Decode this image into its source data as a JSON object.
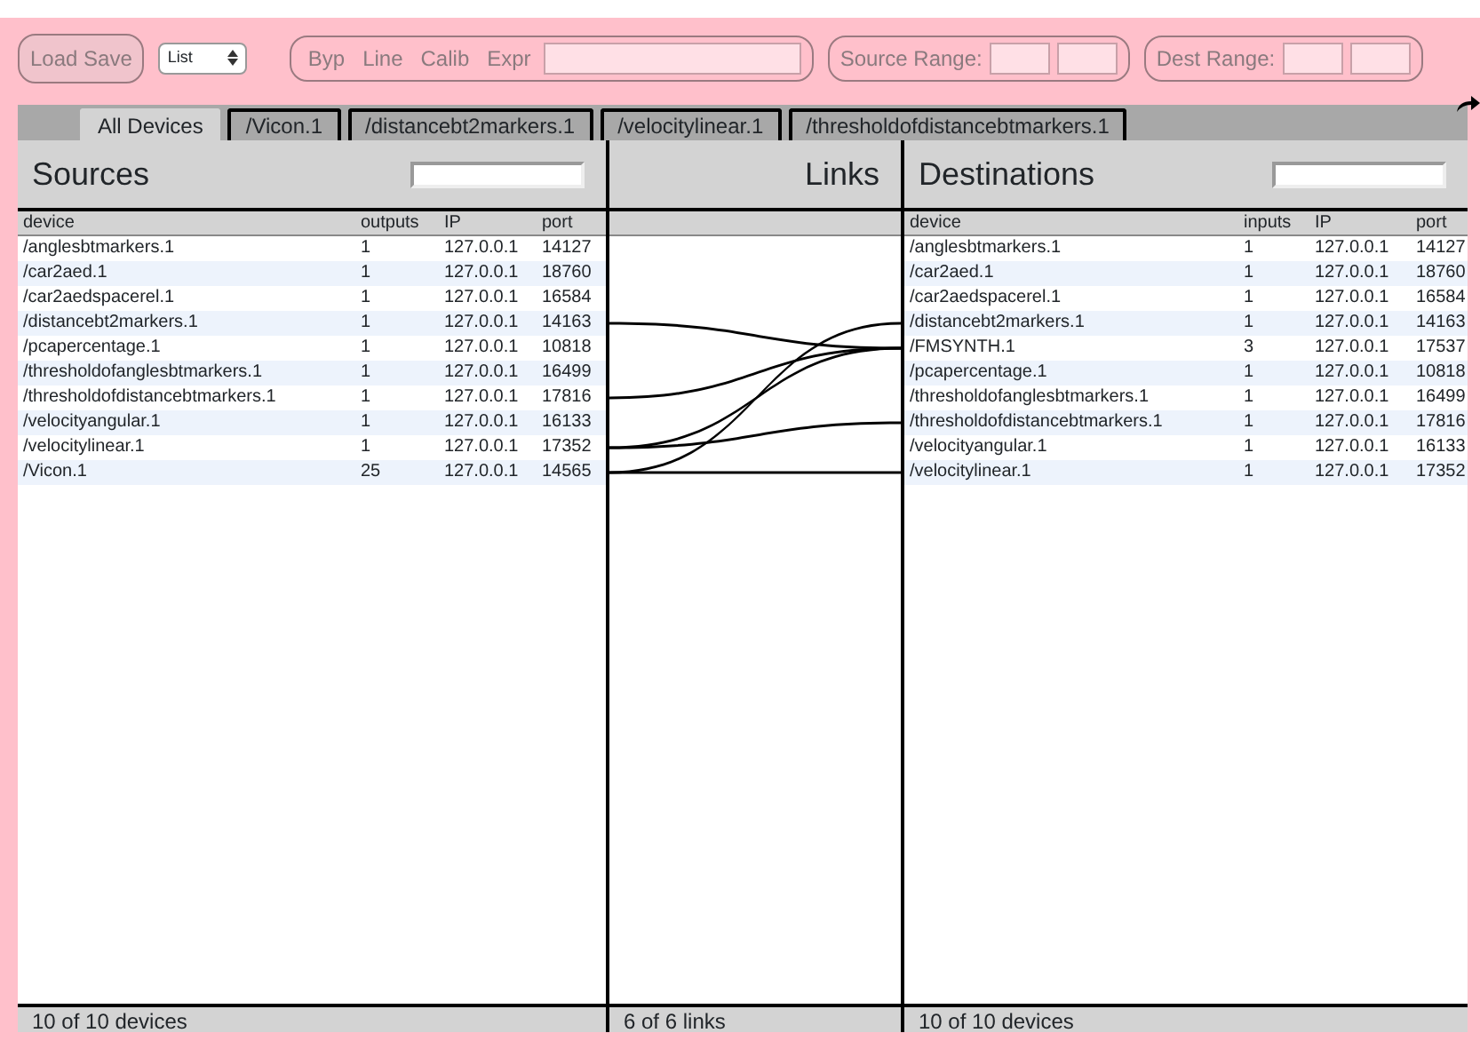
{
  "toolbar": {
    "load_save": "Load Save",
    "view_select": "List",
    "modes": [
      "Byp",
      "Line",
      "Calib",
      "Expr"
    ],
    "source_range_label": "Source Range:",
    "dest_range_label": "Dest Range:"
  },
  "tabs": [
    {
      "label": "All Devices",
      "selected": true
    },
    {
      "label": "/Vicon.1",
      "selected": false
    },
    {
      "label": "/distancebt2markers.1",
      "selected": false
    },
    {
      "label": "/velocitylinear.1",
      "selected": false
    },
    {
      "label": "/thresholdofdistancebtmarkers.1",
      "selected": false
    }
  ],
  "sources": {
    "title": "Sources",
    "columns": [
      "device",
      "outputs",
      "IP",
      "port"
    ],
    "rows": [
      [
        "/anglesbtmarkers.1",
        "1",
        "127.0.0.1",
        "14127"
      ],
      [
        "/car2aed.1",
        "1",
        "127.0.0.1",
        "18760"
      ],
      [
        "/car2aedspacerel.1",
        "1",
        "127.0.0.1",
        "16584"
      ],
      [
        "/distancebt2markers.1",
        "1",
        "127.0.0.1",
        "14163"
      ],
      [
        "/pcapercentage.1",
        "1",
        "127.0.0.1",
        "10818"
      ],
      [
        "/thresholdofanglesbtmarkers.1",
        "1",
        "127.0.0.1",
        "16499"
      ],
      [
        "/thresholdofdistancebtmarkers.1",
        "1",
        "127.0.0.1",
        "17816"
      ],
      [
        "/velocityangular.1",
        "1",
        "127.0.0.1",
        "16133"
      ],
      [
        "/velocitylinear.1",
        "1",
        "127.0.0.1",
        "17352"
      ],
      [
        "/Vicon.1",
        "25",
        "127.0.0.1",
        "14565"
      ]
    ],
    "footer": "10 of 10 devices"
  },
  "links": {
    "title": "Links",
    "footer": "6 of 6 links",
    "connected": [
      [
        false,
        false,
        false,
        false,
        false,
        false,
        false,
        false,
        false,
        false
      ],
      [
        false,
        false,
        false,
        false,
        false,
        false,
        false,
        false,
        false,
        false
      ],
      [
        false,
        false,
        false,
        false,
        false,
        false,
        false,
        false,
        false,
        false
      ],
      [
        false,
        false,
        false,
        false,
        true,
        false,
        false,
        false,
        false,
        false
      ],
      [
        false,
        false,
        false,
        false,
        false,
        false,
        false,
        false,
        false,
        false
      ],
      [
        false,
        false,
        false,
        false,
        false,
        false,
        false,
        false,
        false,
        false
      ],
      [
        false,
        false,
        false,
        false,
        true,
        false,
        false,
        false,
        false,
        false
      ],
      [
        false,
        false,
        false,
        false,
        false,
        false,
        false,
        false,
        false,
        false
      ],
      [
        false,
        false,
        false,
        false,
        true,
        false,
        false,
        true,
        false,
        false
      ],
      [
        false,
        false,
        false,
        true,
        false,
        false,
        false,
        false,
        false,
        true
      ]
    ]
  },
  "destinations": {
    "title": "Destinations",
    "columns": [
      "device",
      "inputs",
      "IP",
      "port"
    ],
    "rows": [
      [
        "/anglesbtmarkers.1",
        "1",
        "127.0.0.1",
        "14127"
      ],
      [
        "/car2aed.1",
        "1",
        "127.0.0.1",
        "18760"
      ],
      [
        "/car2aedspacerel.1",
        "1",
        "127.0.0.1",
        "16584"
      ],
      [
        "/distancebt2markers.1",
        "1",
        "127.0.0.1",
        "14163"
      ],
      [
        "/FMSYNTH.1",
        "3",
        "127.0.0.1",
        "17537"
      ],
      [
        "/pcapercentage.1",
        "1",
        "127.0.0.1",
        "10818"
      ],
      [
        "/thresholdofanglesbtmarkers.1",
        "1",
        "127.0.0.1",
        "16499"
      ],
      [
        "/thresholdofdistancebtmarkers.1",
        "1",
        "127.0.0.1",
        "17816"
      ],
      [
        "/velocityangular.1",
        "1",
        "127.0.0.1",
        "16133"
      ],
      [
        "/velocitylinear.1",
        "1",
        "127.0.0.1",
        "17352"
      ]
    ],
    "footer": "10 of 10 devices"
  }
}
